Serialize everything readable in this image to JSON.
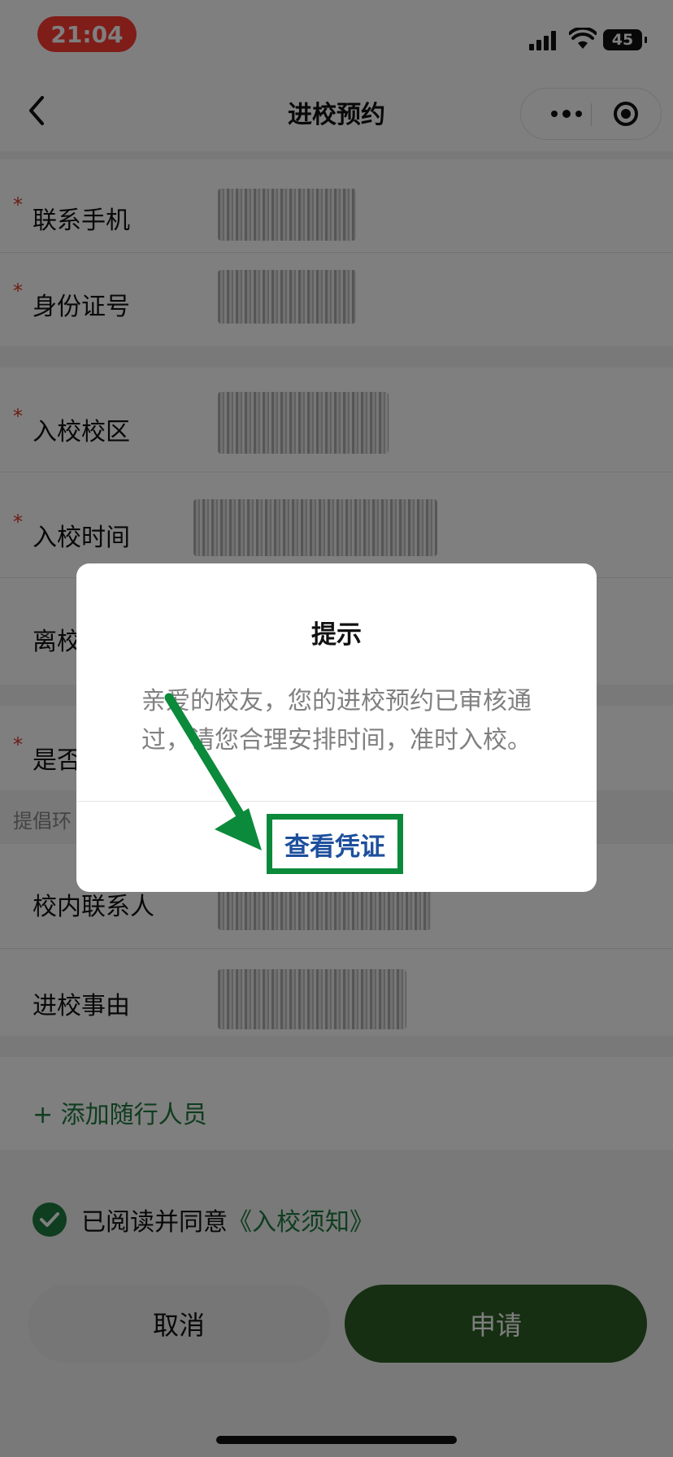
{
  "status_bar": {
    "time": "21:04",
    "battery": "45"
  },
  "nav": {
    "title": "进校预约"
  },
  "form": {
    "fields": [
      {
        "label": "联系手机",
        "required": true
      },
      {
        "label": "身份证号",
        "required": true
      },
      {
        "label": "入校校区",
        "required": true
      },
      {
        "label": "入校时间",
        "required": true
      },
      {
        "label": "离校",
        "required": false
      },
      {
        "label": "是否",
        "required": true
      },
      {
        "label": "校内联系人",
        "required": false
      },
      {
        "label": "进校事由",
        "required": false
      }
    ],
    "hint": "提倡环",
    "add_companion": "+ 添加随行人员",
    "agree_text": "已阅读并同意",
    "agree_link": "《入校须知》"
  },
  "buttons": {
    "cancel": "取消",
    "apply": "申请"
  },
  "dialog": {
    "title": "提示",
    "message": "亲爱的校友，您的进校预约已审核通过，请您合理安排时间，准时入校。",
    "action": "查看凭证"
  },
  "colors": {
    "accent_green": "#1f7a3e",
    "required_red": "#d8392b",
    "annotation_green": "#0a8a3a",
    "link_blue": "#1d4f9c"
  }
}
